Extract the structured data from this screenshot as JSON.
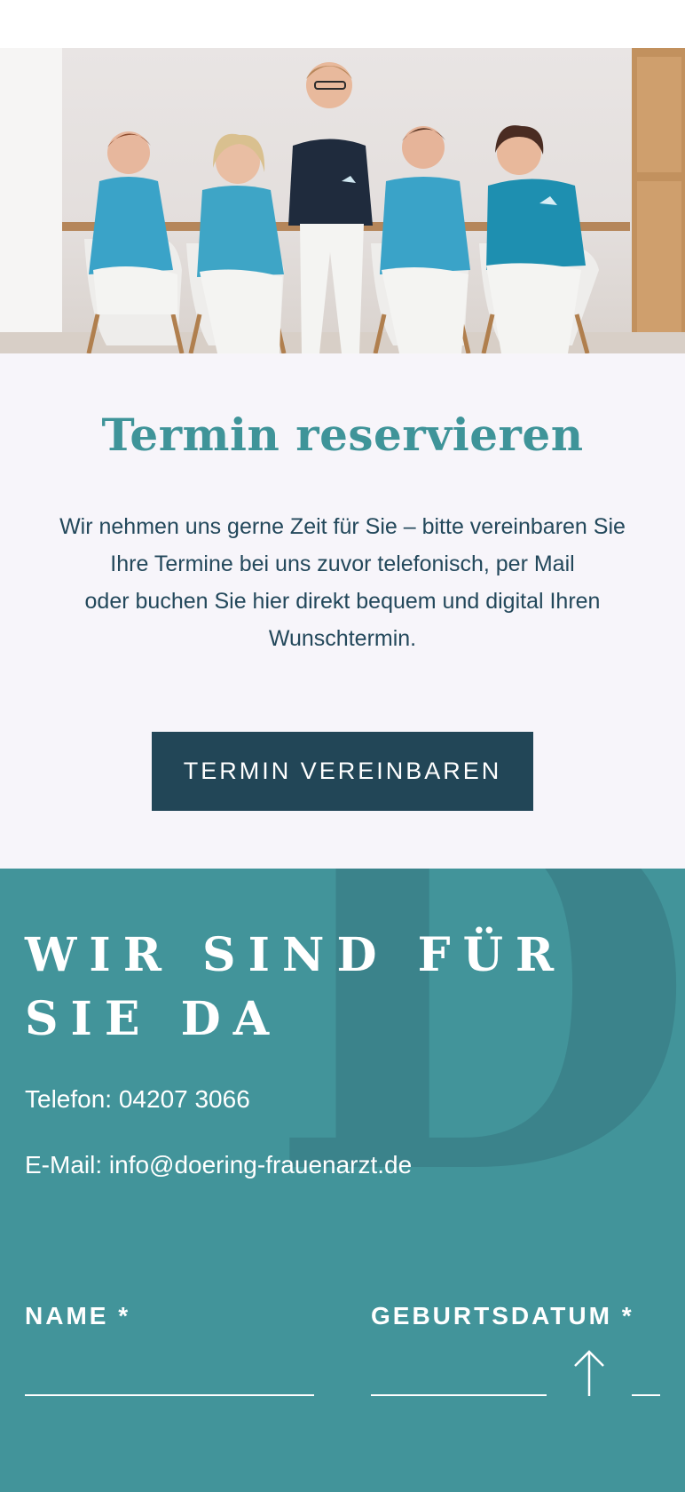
{
  "hero": {
    "image_alt": "Praxisteam",
    "colors": {
      "wall": "#e6e2e1",
      "teal_jacket": "#3aa3c8",
      "navy_polo": "#1f2b3d",
      "trousers": "#f4f4f2",
      "chair": "#f1f0ee",
      "wood": "#b07f4e"
    }
  },
  "appointment": {
    "title": "Termin reservieren",
    "text_lines": [
      "Wir nehmen uns gerne Zeit für Sie – bitte vereinbaren Sie",
      "Ihre Termine bei uns zuvor telefonisch, per Mail",
      "oder buchen Sie hier direkt bequem und digital Ihren",
      "Wunschtermin."
    ],
    "button_label": "TERMIN VEREINBAREN"
  },
  "contact": {
    "title_lines": [
      "WIR SIND FÜR",
      "SIE DA"
    ],
    "decor_letter": "D",
    "phone": "Telefon: 04207 3066",
    "email": "E-Mail: info@doering-frauenarzt.de",
    "form": {
      "name_label": "NAME *",
      "birth_label": "GEBURTSDATUM *"
    },
    "scroll_top_icon": "arrow-up-icon"
  },
  "colors": {
    "accent_teal": "#3f9499",
    "section_teal": "#42949a",
    "button_navy": "#224657",
    "light_bg": "#f7f5fa"
  }
}
